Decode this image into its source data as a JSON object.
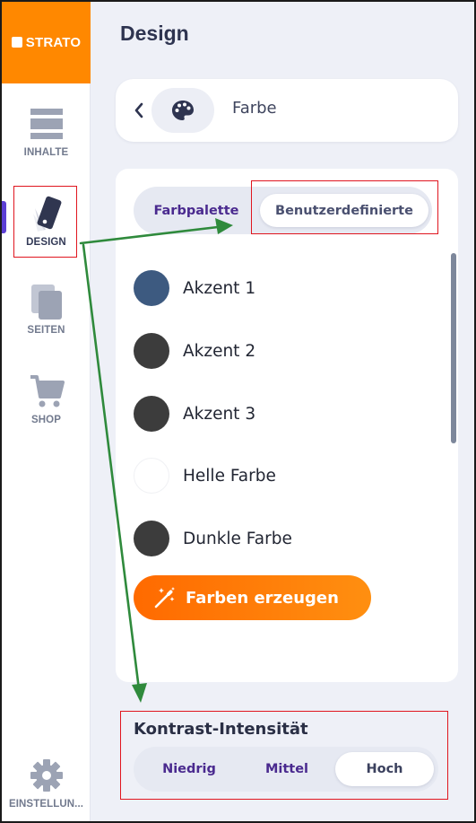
{
  "brand": {
    "name": "STRATO",
    "color": "#ff8800"
  },
  "sidebar": {
    "items": [
      {
        "label": "INHALTE",
        "icon": "content-icon"
      },
      {
        "label": "DESIGN",
        "icon": "design-swatch-icon",
        "active": true
      },
      {
        "label": "SEITEN",
        "icon": "pages-icon"
      },
      {
        "label": "SHOP",
        "icon": "cart-icon"
      }
    ],
    "settings": {
      "label": "EINSTELLUN...",
      "icon": "gear-icon"
    }
  },
  "page": {
    "title": "Design"
  },
  "section": {
    "title": "Farbe",
    "icon": "palette-icon"
  },
  "tabs": [
    {
      "label": "Farbpalette",
      "selected": false
    },
    {
      "label": "Benutzerdefinierte",
      "selected": true
    }
  ],
  "colors": [
    {
      "label": "Akzent 1",
      "hex": "#3d5a80"
    },
    {
      "label": "Akzent 2",
      "hex": "#3c3c3c"
    },
    {
      "label": "Akzent 3",
      "hex": "#3c3c3c"
    },
    {
      "label": "Helle Farbe",
      "hex": "#ffffff"
    },
    {
      "label": "Dunkle Farbe",
      "hex": "#3c3c3c"
    }
  ],
  "generate_button": {
    "label": "Farben erzeugen",
    "icon": "magic-wand-icon"
  },
  "contrast": {
    "title": "Kontrast-Intensität",
    "options": [
      {
        "label": "Niedrig",
        "selected": false
      },
      {
        "label": "Mittel",
        "selected": false
      },
      {
        "label": "Hoch",
        "selected": true
      }
    ]
  },
  "annotation_colors": {
    "highlight_box": "#e0161f",
    "arrow": "#2f8a3c"
  }
}
